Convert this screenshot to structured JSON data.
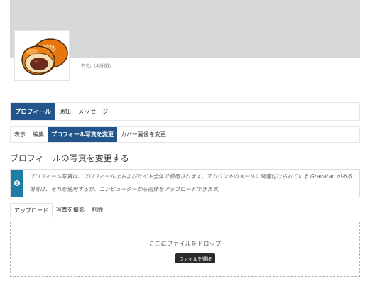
{
  "profile": {
    "status": "有効（4分前）"
  },
  "nav_main": {
    "items": [
      {
        "label": "プロフィール"
      },
      {
        "label": "通知"
      },
      {
        "label": "メッセージ"
      }
    ]
  },
  "nav_sub": {
    "items": [
      {
        "label": "表示"
      },
      {
        "label": "編集"
      },
      {
        "label": "プロフィール写真を変更"
      },
      {
        "label": "カバー画像を変更"
      }
    ]
  },
  "page": {
    "title": "プロフィールの写真を変更する"
  },
  "notice": {
    "icon": "info-icon",
    "line1": "プロフィール写真は、プロフィール上およびサイト全体で使用されます。アカウントのメールに関連付けられている Gravatar がある",
    "line2": "場合は、それを使用するか、コンピューターから画像をアップロードできます。"
  },
  "upload_tabs": {
    "items": [
      {
        "label": "アップロード"
      },
      {
        "label": "写真を撮影"
      },
      {
        "label": "削除"
      }
    ]
  },
  "dropzone": {
    "text": "ここにファイルをドロップ",
    "button_label": "ファイルを選択"
  },
  "colors": {
    "accent": "#21558c",
    "info": "#1d7ea5"
  }
}
